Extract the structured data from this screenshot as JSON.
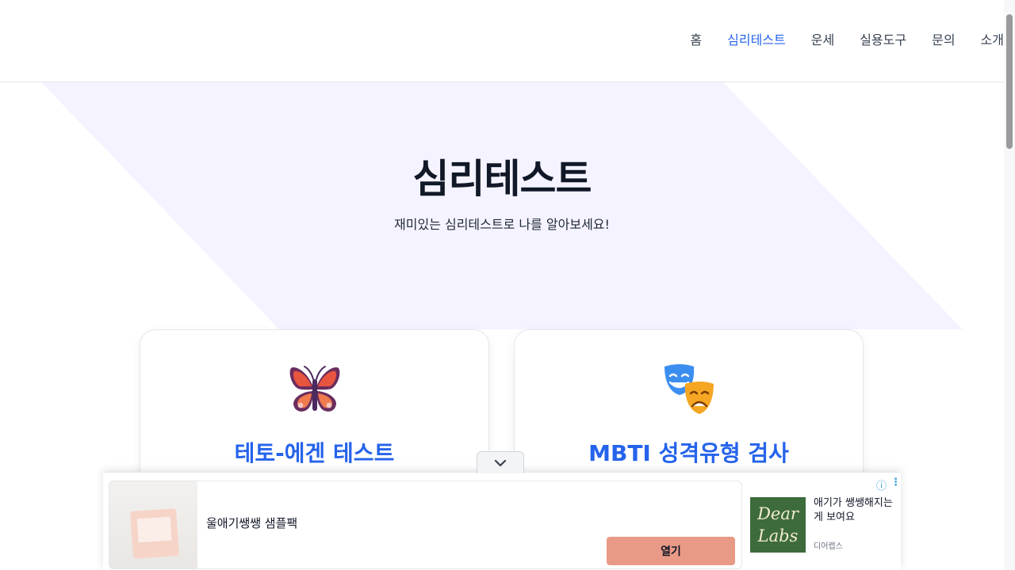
{
  "nav": {
    "items": [
      "홈",
      "심리테스트",
      "운세",
      "실용도구",
      "문의",
      "소개"
    ],
    "active_index": 1
  },
  "hero": {
    "title": "심리테스트",
    "subtitle": "재미있는 심리테스트로 나를 알아보세요!"
  },
  "cards": [
    {
      "title": "테토-에겐 테스트",
      "icon": "butterfly-icon"
    },
    {
      "title": "MBTI 성격유형 검사",
      "icon": "theater-masks-icon"
    }
  ],
  "ad": {
    "headline": "울애기쌩쌩 샘플팩",
    "open_label": "열기",
    "logo_line1": "Dear",
    "logo_line2": "Labs",
    "description": "애기가 쌩쌩해지는 게 보여요",
    "brand": "디어랩스",
    "info_symbol": "ⓘ",
    "menu_symbol": "⋮"
  },
  "colors": {
    "accent": "#2563eb",
    "hero_bg": "#f5f3ff",
    "ad_button": "#e99a86"
  }
}
